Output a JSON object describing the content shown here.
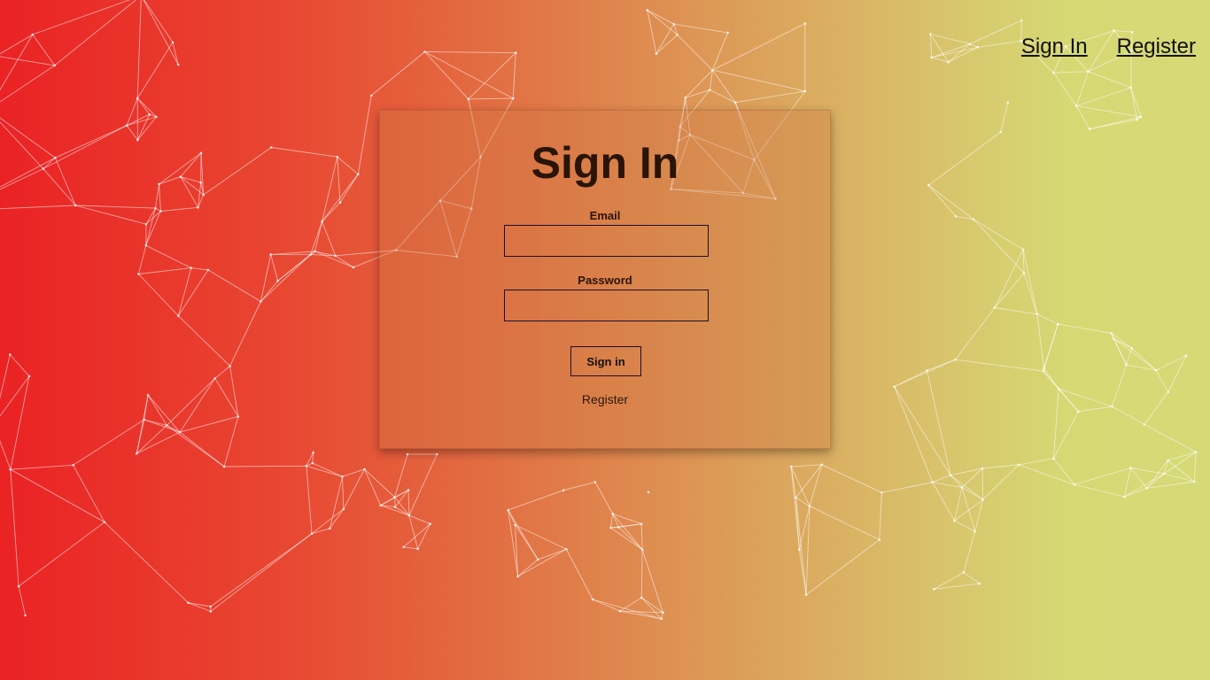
{
  "nav": {
    "signin_label": "Sign In",
    "register_label": "Register"
  },
  "form": {
    "title": "Sign In",
    "email_label": "Email",
    "email_value": "",
    "password_label": "Password",
    "password_value": "",
    "submit_label": "Sign in",
    "register_link": "Register"
  },
  "colors": {
    "gradient_left": "#ea2224",
    "gradient_right": "#d6da76",
    "text_dark": "#2a1408"
  }
}
